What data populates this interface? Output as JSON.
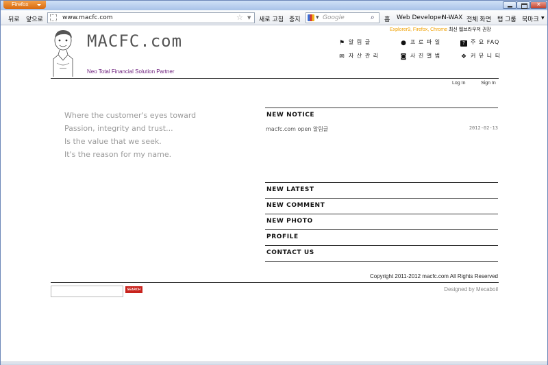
{
  "browser": {
    "menu_button": "Firefox",
    "back": "뒤로",
    "forward": "앞으로",
    "url": "www.macfc.com",
    "reload": "새로 고침",
    "stop": "중지",
    "search_placeholder": "Google",
    "home": "홈",
    "toolbar": [
      "Web Developer",
      "N-WAX",
      "전체 화면",
      "탭 그룹",
      "북마크"
    ]
  },
  "site": {
    "browser_note_highlight": "Explorer9, Firefox, Chrome",
    "browser_note_rest": " 최신 웹브라우저 권장",
    "logo": "MACFC.com",
    "tagline": "Neo Total Financial Solution Partner",
    "nav": [
      {
        "label": "알 림 글",
        "icon": "flag-icon"
      },
      {
        "label": "프 로 파 일",
        "icon": "person-icon"
      },
      {
        "label": "주 요 FAQ",
        "icon": "question-icon"
      },
      {
        "label": "자 산 관 리",
        "icon": "mail-icon"
      },
      {
        "label": "사 진 앨 범",
        "icon": "camera-icon"
      },
      {
        "label": "커 뮤 니 티",
        "icon": "chat-icon"
      }
    ],
    "login": "Log In",
    "signin": "Sign In",
    "quote": [
      "Where the customer's eyes toward",
      "Passion, integrity and trust...",
      "Is the value that we seek.",
      "It's the reason for my name."
    ],
    "sections": {
      "notice": "NEW NOTICE",
      "latest": "NEW LATEST",
      "comment": "NEW COMMENT",
      "photo": "NEW PHOTO",
      "profile": "PROFILE",
      "contact": "CONTACT US"
    },
    "notice_item": {
      "title": "macfc.com open 알림글",
      "date": "2012-02-13"
    },
    "copyright": "Copyright 2011-2012 macfc.com All Rights Reserved",
    "search_button": "SEARCH",
    "designed_by": "Designed by Mecaboil"
  }
}
